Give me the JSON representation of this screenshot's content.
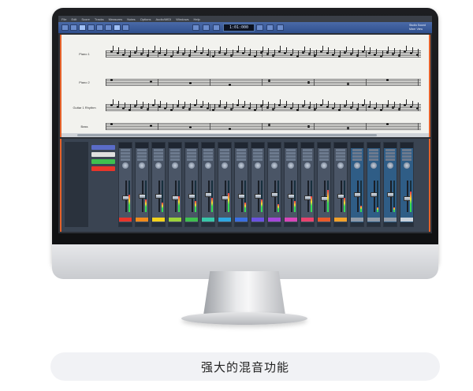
{
  "app": {
    "menu": [
      "File",
      "Edit",
      "Score",
      "Tracks",
      "Measures",
      "Notes",
      "Options",
      "Audio/MIDI",
      "Windows",
      "Help"
    ],
    "transport_time": "1:01:000",
    "toolbar_right": [
      "Studio Sound",
      "Mixer View"
    ]
  },
  "score": {
    "staves": [
      {
        "label": "Piano 1"
      },
      {
        "label": "Piano 2"
      },
      {
        "label": "Guitar 1 Rhythm"
      },
      {
        "label": "Bass"
      }
    ]
  },
  "mixer": {
    "channels": [
      {
        "name": "Piano 1",
        "io": "Audio Out",
        "color": "#e8352a",
        "level": 0.55,
        "fader": 0.45
      },
      {
        "name": "Piano 2",
        "io": "Audio Out",
        "color": "#f08a1c",
        "level": 0.4,
        "fader": 0.5
      },
      {
        "name": "Strings",
        "io": "Audio Out",
        "color": "#f3d21c",
        "level": 0.3,
        "fader": 0.5
      },
      {
        "name": "Guitar",
        "io": "Audio Out",
        "color": "#9bd13a",
        "level": 0.5,
        "fader": 0.45
      },
      {
        "name": "Organ",
        "io": "Audio Out",
        "color": "#3fbf4f",
        "level": 0.35,
        "fader": 0.5
      },
      {
        "name": "Brass",
        "io": "Audio Out",
        "color": "#38c6a8",
        "level": 0.45,
        "fader": 0.55
      },
      {
        "name": "Bass",
        "io": "Audio Out",
        "color": "#2fa6e0",
        "level": 0.6,
        "fader": 0.45
      },
      {
        "name": "Synth",
        "io": "Audio Out",
        "color": "#3a6fe0",
        "level": 0.3,
        "fader": 0.5
      },
      {
        "name": "Lead",
        "io": "Audio Out",
        "color": "#6a52e0",
        "level": 0.4,
        "fader": 0.5
      },
      {
        "name": "Flute",
        "io": "Audio Out",
        "color": "#a447d8",
        "level": 0.25,
        "fader": 0.55
      },
      {
        "name": "Pad",
        "io": "Audio Out",
        "color": "#d846b8",
        "level": 0.35,
        "fader": 0.5
      },
      {
        "name": "Choir",
        "io": "Audio Out",
        "color": "#e8436e",
        "level": 0.5,
        "fader": 0.45
      },
      {
        "name": "Drums",
        "io": "Audio Out",
        "color": "#e85a2a",
        "level": 0.7,
        "fader": 0.4
      },
      {
        "name": "Perc",
        "io": "Audio Out",
        "color": "#f2a12a",
        "level": 0.45,
        "fader": 0.5
      },
      {
        "name": "Reverb",
        "io": "Audio Out",
        "color": "#8f9aa8",
        "level": 0.2,
        "fader": 0.55,
        "bus": true
      },
      {
        "name": "Delay",
        "io": "Audio Out",
        "color": "#8f9aa8",
        "level": 0.15,
        "fader": 0.55,
        "bus": true
      },
      {
        "name": "Chorus",
        "io": "Audio Out",
        "color": "#8f9aa8",
        "level": 0.15,
        "fader": 0.55,
        "bus": true
      },
      {
        "name": "Master",
        "io": "Main Out",
        "color": "#c8d0da",
        "level": 0.65,
        "fader": 0.4,
        "bus": true
      }
    ],
    "master_label": "Audio Out",
    "route_colors": [
      "#5a6cc8",
      "#e0e0e0",
      "#3fbf4f",
      "#e8352a"
    ]
  },
  "caption": "强大的混音功能"
}
